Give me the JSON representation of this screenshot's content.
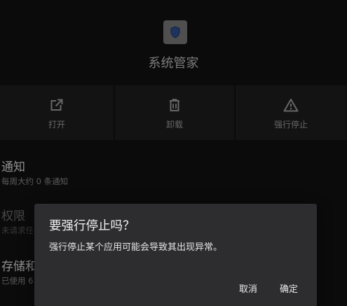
{
  "app": {
    "name": "系统管家",
    "icon": "shield-icon"
  },
  "actions": [
    {
      "label": "打开",
      "icon": "open-external-icon"
    },
    {
      "label": "卸载",
      "icon": "trash-icon"
    },
    {
      "label": "强行停止",
      "icon": "warning-icon"
    }
  ],
  "sections": {
    "notifications": {
      "title": "通知",
      "subtitle": "每周大约 0 条通知"
    },
    "permissions": {
      "title": "权限",
      "subtitle": "未请求任"
    },
    "storage": {
      "title": "存储和",
      "subtitle": "已使用 6"
    }
  },
  "dialog": {
    "title": "要强行停止吗？",
    "message": "强行停止某个应用可能会导致其出现异常。",
    "cancel_label": "取消",
    "ok_label": "确定"
  },
  "colors": {
    "background": "#121212",
    "dialog": "#2d2d30",
    "icon_tile": "#7a7a7a",
    "shield": "#2f4f8f"
  }
}
